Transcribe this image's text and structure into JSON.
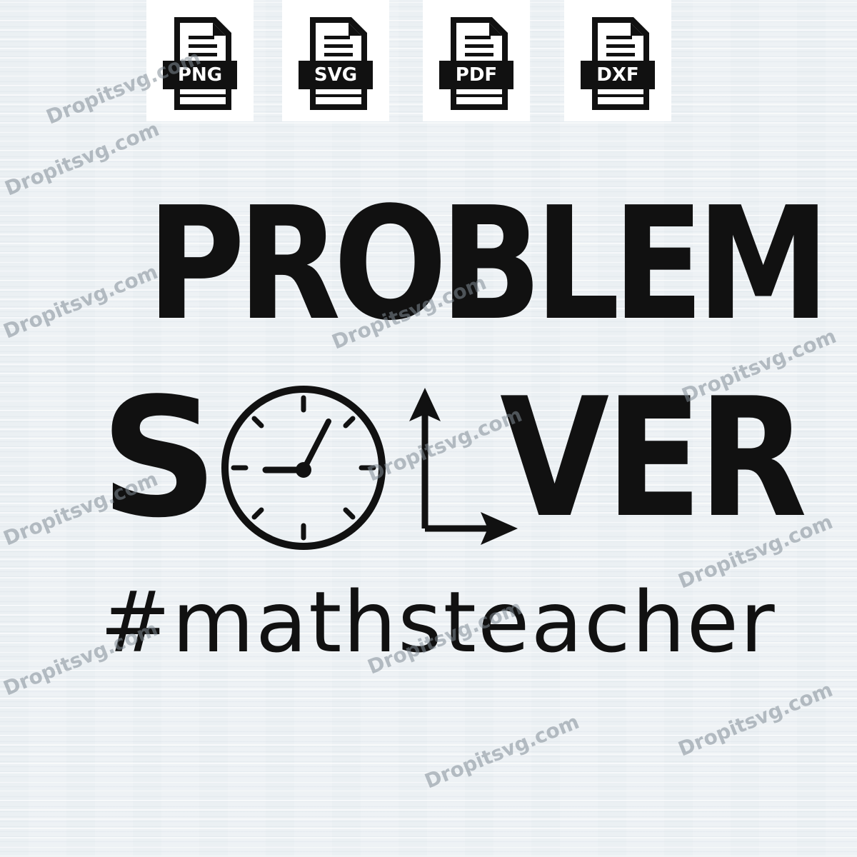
{
  "format_badges": [
    {
      "label": "PNG"
    },
    {
      "label": "SVG"
    },
    {
      "label": "PDF"
    },
    {
      "label": "DXF"
    }
  ],
  "design": {
    "line1": "PROBLEM",
    "line2_start": "S",
    "line2_end": "VER",
    "line3": "#mathsteacher"
  },
  "watermark": {
    "text": "Dropitsvg.com"
  },
  "colors": {
    "ink": "#111111",
    "background": "#eef2f5",
    "tile": "#ffffff"
  }
}
